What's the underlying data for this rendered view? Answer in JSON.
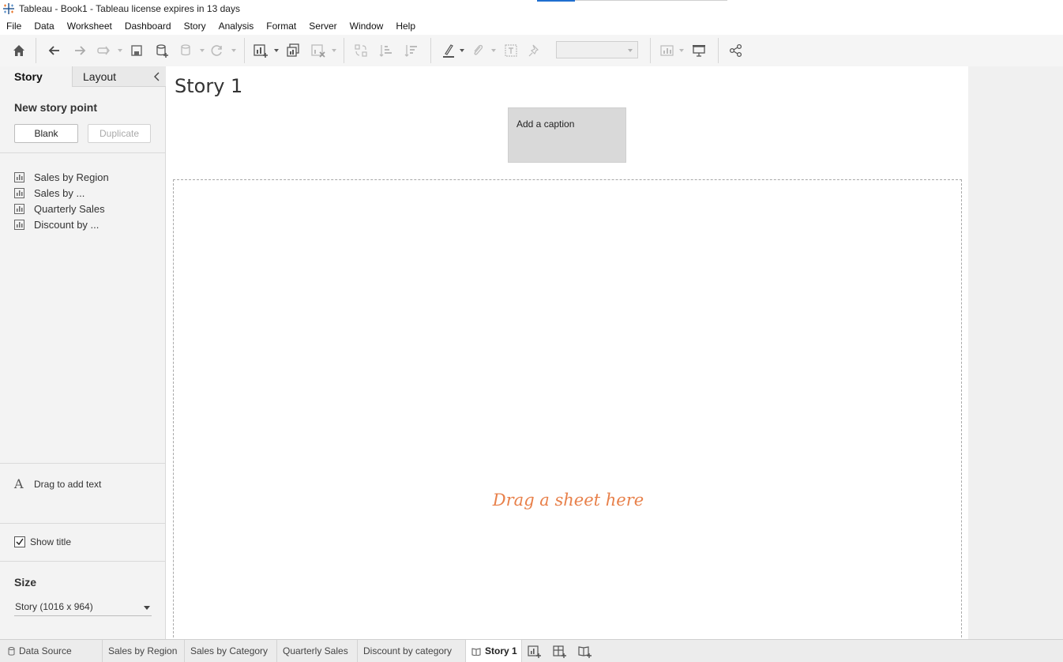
{
  "window": {
    "title": "Tableau - Book1 - Tableau license expires in 13 days"
  },
  "menu": [
    "File",
    "Data",
    "Worksheet",
    "Dashboard",
    "Story",
    "Analysis",
    "Format",
    "Server",
    "Window",
    "Help"
  ],
  "panel": {
    "tabs": {
      "story": "Story",
      "layout": "Layout"
    },
    "new_story_point": {
      "title": "New story point",
      "blank_label": "Blank",
      "duplicate_label": "Duplicate"
    },
    "sheets": [
      "Sales by Region",
      "Sales by ...",
      "Quarterly Sales",
      "Discount by ..."
    ],
    "drag_text": {
      "icon_glyph": "A",
      "label": "Drag to add text"
    },
    "show_title": {
      "label": "Show title",
      "checked": true
    },
    "size": {
      "title": "Size",
      "value": "Story (1016 x 964)"
    }
  },
  "canvas": {
    "story_title": "Story 1",
    "caption_placeholder": "Add a caption",
    "drop_hint": "Drag a sheet here"
  },
  "bottom_tabs": {
    "data_source": "Data Source",
    "sheets": [
      "Sales by Region",
      "Sales by Category",
      "Quarterly Sales",
      "Discount by category"
    ],
    "active_story": "Story 1"
  },
  "colors": {
    "accent_orange": "#e8804a",
    "toolbar_bg": "#f5f5f5",
    "panel_bg": "#f3f3f3"
  }
}
